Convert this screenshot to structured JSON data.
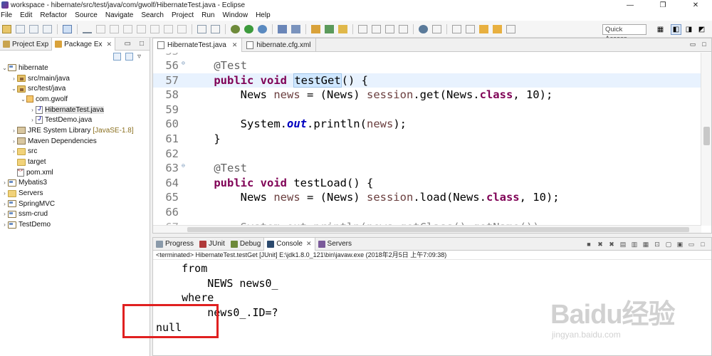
{
  "window": {
    "title": "workspace - hibernate/src/test/java/com/gwolf/HibernateTest.java - Eclipse",
    "controls": [
      "—",
      "❐",
      "✕"
    ]
  },
  "menu": [
    "File",
    "Edit",
    "Refactor",
    "Source",
    "Navigate",
    "Search",
    "Project",
    "Run",
    "Window",
    "Help"
  ],
  "toolbar": {
    "quick_access": "Quick Access"
  },
  "left_pane": {
    "tabs": [
      {
        "label": "Project Exp",
        "active": false
      },
      {
        "label": "Package Ex",
        "active": true
      }
    ],
    "tree": [
      {
        "label": "hibernate",
        "icon": "project-icon",
        "decoration": ""
      },
      {
        "label": "src/main/java",
        "icon": "source-folder-icon",
        "decoration": ""
      },
      {
        "label": "src/test/java",
        "icon": "source-folder-icon",
        "decoration": ""
      },
      {
        "label": "com.gwolf",
        "icon": "package-icon",
        "decoration": ""
      },
      {
        "label": "HibernateTest.java",
        "icon": "java-file-icon",
        "decoration": ""
      },
      {
        "label": "TestDemo.java",
        "icon": "java-file-icon",
        "decoration": ""
      },
      {
        "label": "JRE System Library",
        "icon": "library-icon",
        "decoration": "[JavaSE-1.8]"
      },
      {
        "label": "Maven Dependencies",
        "icon": "library-icon",
        "decoration": ""
      },
      {
        "label": "src",
        "icon": "folder-icon",
        "decoration": ""
      },
      {
        "label": "target",
        "icon": "folder-icon",
        "decoration": ""
      },
      {
        "label": "pom.xml",
        "icon": "xml-file-icon",
        "decoration": ""
      },
      {
        "label": "Mybatis3",
        "icon": "project-icon",
        "decoration": ""
      },
      {
        "label": "Servers",
        "icon": "folder-icon",
        "decoration": ""
      },
      {
        "label": "SpringMVC",
        "icon": "project-icon",
        "decoration": ""
      },
      {
        "label": "ssm-crud",
        "icon": "project-icon",
        "decoration": ""
      },
      {
        "label": "TestDemo",
        "icon": "project-icon",
        "decoration": ""
      }
    ]
  },
  "editor": {
    "tabs": [
      {
        "label": "HibernateTest.java",
        "active": true
      },
      {
        "label": "hibernate.cfg.xml",
        "active": false
      }
    ],
    "lines": [
      {
        "num": "56",
        "text": "    @Test"
      },
      {
        "num": "57",
        "text": "    public void testGet() {"
      },
      {
        "num": "58",
        "text": "        News news = (News) session.get(News.class, 10);"
      },
      {
        "num": "59",
        "text": ""
      },
      {
        "num": "60",
        "text": "        System.out.println(news);"
      },
      {
        "num": "61",
        "text": "    }"
      },
      {
        "num": "62",
        "text": ""
      },
      {
        "num": "63",
        "text": "    @Test"
      },
      {
        "num": "64",
        "text": "    public void testLoad() {"
      },
      {
        "num": "65",
        "text": "        News news = (News) session.load(News.class, 10);"
      },
      {
        "num": "66",
        "text": ""
      }
    ],
    "selected_word": "testGet"
  },
  "console": {
    "tabs": [
      "Progress",
      "JUnit",
      "Debug",
      "Console",
      "Servers"
    ],
    "active_tab": "Console",
    "status": "<terminated> HibernateTest.testGet [JUnit] E:\\jdk1.8.0_121\\bin\\javaw.exe (2018年2月5日 上午7:09:38)",
    "output": [
      "    from",
      "        NEWS news0_",
      "    where",
      "        news0_.ID=?",
      "null"
    ]
  },
  "watermark": {
    "logo": "Baidu经验",
    "url": "jingyan.baidu.com"
  }
}
